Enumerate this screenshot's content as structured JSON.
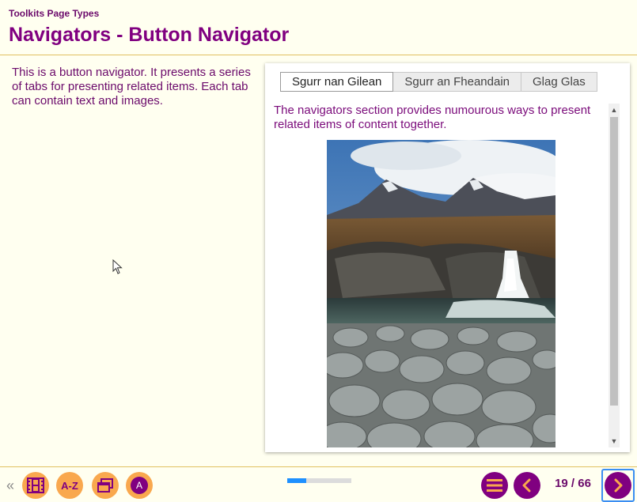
{
  "header": {
    "breadcrumb": "Toolkits Page Types",
    "title": "Navigators - Button Navigator"
  },
  "intro": {
    "text": "This is a button navigator. It presents a series of tabs for presenting related items. Each tab can contain text and images."
  },
  "navigator": {
    "tabs": [
      "Sgurr nan Gilean",
      "Sgurr an Fheandain",
      "Glag Glas"
    ],
    "active_tab": "Sgurr nan Gilean",
    "content_text": "The navigators section provides numourous ways to present related items of content together."
  },
  "footer": {
    "buttons": [
      {
        "name": "video",
        "icon": "film-icon"
      },
      {
        "name": "glossary",
        "label": "A-Z"
      },
      {
        "name": "resources",
        "icon": "windows-icon"
      },
      {
        "name": "accessibility",
        "label": "A"
      }
    ],
    "progress": 0.3,
    "page_counter": "19 / 66",
    "nav": {
      "menu": "menu-icon",
      "prev": "chevron-left-icon",
      "next": "chevron-right-icon"
    }
  },
  "colors": {
    "background": "#fffff0",
    "heading": "#800080",
    "accent_orange": "#f9a84e",
    "progress": "#1e90ff"
  }
}
